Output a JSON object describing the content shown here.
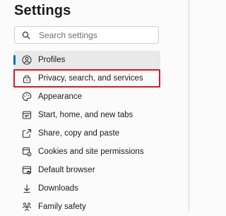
{
  "page": {
    "title": "Settings"
  },
  "search": {
    "placeholder": "Search settings",
    "icon": "search-icon"
  },
  "nav": {
    "items": [
      {
        "label": "Profiles",
        "icon": "profile-icon",
        "selected": true
      },
      {
        "label": "Privacy, search, and services",
        "icon": "lock-icon",
        "highlighted": true
      },
      {
        "label": "Appearance",
        "icon": "appearance-icon"
      },
      {
        "label": "Start, home, and new tabs",
        "icon": "home-tabs-icon"
      },
      {
        "label": "Share, copy and paste",
        "icon": "share-icon"
      },
      {
        "label": "Cookies and site permissions",
        "icon": "cookies-icon"
      },
      {
        "label": "Default browser",
        "icon": "browser-icon"
      },
      {
        "label": "Downloads",
        "icon": "download-icon"
      },
      {
        "label": "Family safety",
        "icon": "family-icon"
      }
    ]
  },
  "colors": {
    "accent": "#0f6cbd",
    "highlight_border": "#d11f25",
    "selected_bg": "#e9e9e9"
  }
}
